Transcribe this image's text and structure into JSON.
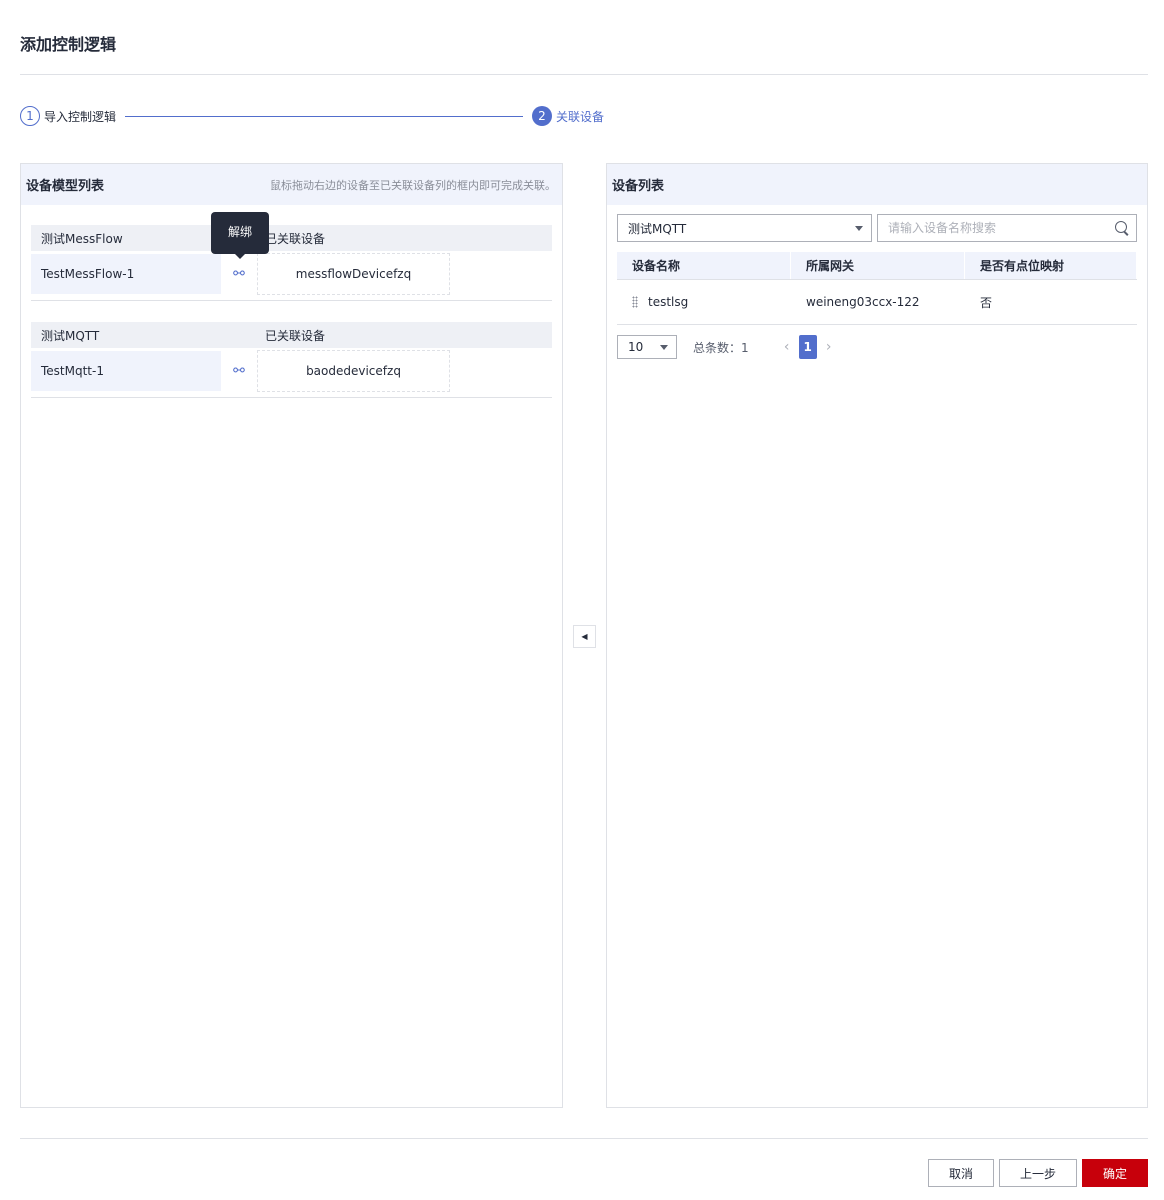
{
  "dialog": {
    "title": "添加控制逻辑"
  },
  "steps": [
    {
      "num": "1",
      "label": "导入控制逻辑"
    },
    {
      "num": "2",
      "label": "关联设备"
    }
  ],
  "left_panel": {
    "title": "设备模型列表",
    "hint": "鼠标拖动右边的设备至已关联设备列的框内即可完成关联。",
    "tooltip": "解绑",
    "models": [
      {
        "name": "测试MessFlow",
        "linked_header": "已关联设备",
        "instance": "TestMessFlow-1",
        "device": "messflowDevicefzq"
      },
      {
        "name": "测试MQTT",
        "linked_header": "已关联设备",
        "instance": "TestMqtt-1",
        "device": "baodedevicefzq"
      }
    ]
  },
  "right_panel": {
    "title": "设备列表",
    "model_select": "测试MQTT",
    "search_placeholder": "请输入设备名称搜索",
    "columns": [
      "设备名称",
      "所属网关",
      "是否有点位映射"
    ],
    "rows": [
      {
        "name": "testlsg",
        "gateway": "weineng03ccx-122",
        "mapping": "否"
      }
    ],
    "pager": {
      "page_size": "10",
      "total": "总条数：1",
      "current": "1"
    }
  },
  "footer": {
    "cancel": "取消",
    "prev": "上一步",
    "ok": "确定"
  },
  "colors": {
    "accent": "#526ecc",
    "primary_button": "#c7000b",
    "panel_header": "#f0f3fc"
  }
}
